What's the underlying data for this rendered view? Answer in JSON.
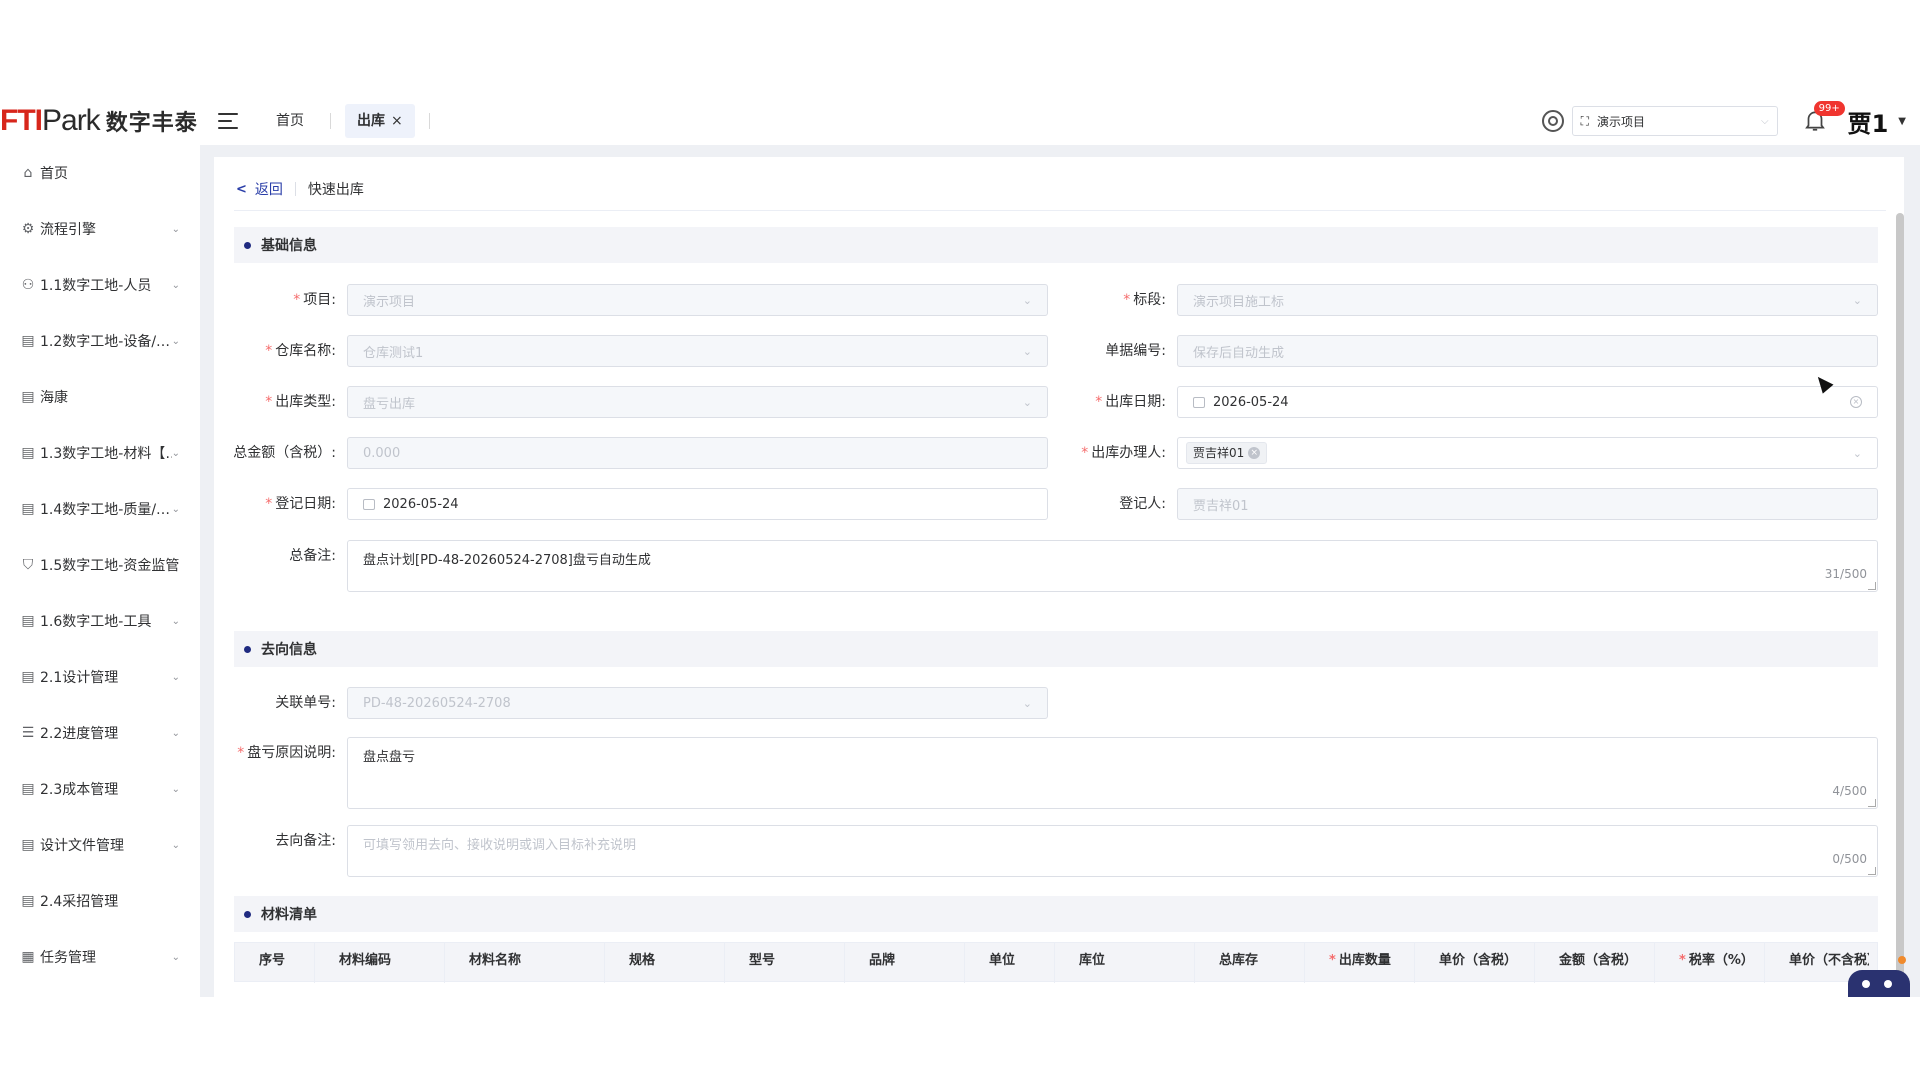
{
  "header": {
    "logo_mark_red": "FTI",
    "logo_mark_dark": "Park",
    "logo_cn": "数字丰泰",
    "tabs": [
      {
        "label": "首页"
      },
      {
        "label": "出库",
        "close": "×"
      }
    ],
    "project": "演示项目",
    "badge": "99+",
    "user": "贾1"
  },
  "sidebar": {
    "items": [
      {
        "label": "首页",
        "icon": "home-icon"
      },
      {
        "label": "流程引擎",
        "icon": "workflow-icon"
      },
      {
        "label": "1.1数字工地-人员",
        "icon": "people-icon"
      },
      {
        "label": "1.2数字工地-设备/…",
        "icon": "doc-icon"
      },
      {
        "label": "海康",
        "icon": "doc-icon"
      },
      {
        "label": "1.3数字工地-材料【…",
        "icon": "doc-icon"
      },
      {
        "label": "1.4数字工地-质量/…",
        "icon": "doc-icon"
      },
      {
        "label": "1.5数字工地-资金监管",
        "icon": "shield-icon"
      },
      {
        "label": "1.6数字工地-工具",
        "icon": "doc-icon"
      },
      {
        "label": "2.1设计管理",
        "icon": "doc-icon"
      },
      {
        "label": "2.2进度管理",
        "icon": "gantt-icon"
      },
      {
        "label": "2.3成本管理",
        "icon": "doc-icon"
      },
      {
        "label": "设计文件管理",
        "icon": "doc-icon"
      },
      {
        "label": "2.4采招管理",
        "icon": "doc-icon"
      },
      {
        "label": "任务管理",
        "icon": "briefcase-icon"
      }
    ]
  },
  "breadcrumb": {
    "back": "返回",
    "current": "快速出库"
  },
  "basic": {
    "title": "基础信息",
    "project_label": "项目:",
    "project_value": "演示项目",
    "section_label": "标段:",
    "section_value": "演示项目施工标",
    "warehouse_label": "仓库名称:",
    "warehouse_value": "仓库测试1",
    "doc_no_label": "单据编号:",
    "doc_no_placeholder": "保存后自动生成",
    "out_type_label": "出库类型:",
    "out_type_value": "盘亏出库",
    "out_date_label": "出库日期:",
    "out_date_value": "2026-05-24",
    "total_label": "总金额（含税）:",
    "total_value": "0.000",
    "handler_label": "出库办理人:",
    "handler_value": "贾吉祥01",
    "reg_date_label": "登记日期:",
    "reg_date_value": "2026-05-24",
    "registrant_label": "登记人:",
    "registrant_value": "贾吉祥01",
    "remark_label": "总备注:",
    "remark_value": "盘点计划[PD-48-20260524-2708]盘亏自动生成",
    "remark_count": "31/500"
  },
  "destination": {
    "title": "去向信息",
    "related_label": "关联单号:",
    "related_value": "PD-48-20260524-2708",
    "reason_label": "盘亏原因说明:",
    "reason_value": "盘点盘亏",
    "reason_count": "4/500",
    "dest_remark_label": "去向备注:",
    "dest_remark_placeholder": "可填写领用去向、接收说明或调入目标补充说明",
    "dest_remark_count": "0/500"
  },
  "materials": {
    "title": "材料清单",
    "columns": [
      "序号",
      "材料编码",
      "材料名称",
      "规格",
      "型号",
      "品牌",
      "单位",
      "库位",
      "总库存",
      "出库数量",
      "单价（含税）",
      "金额（含税）",
      "税率（%）",
      "单价（不含税）"
    ]
  }
}
